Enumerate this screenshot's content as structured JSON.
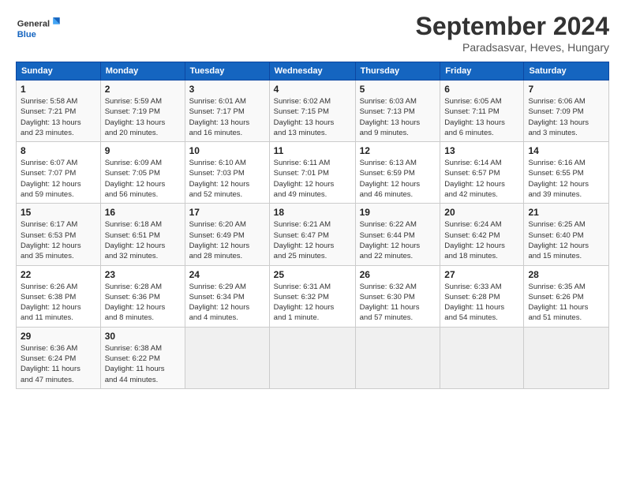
{
  "header": {
    "logo_line1": "General",
    "logo_line2": "Blue",
    "month_year": "September 2024",
    "location": "Paradsasvar, Heves, Hungary"
  },
  "days_of_week": [
    "Sunday",
    "Monday",
    "Tuesday",
    "Wednesday",
    "Thursday",
    "Friday",
    "Saturday"
  ],
  "weeks": [
    [
      {
        "day": "1",
        "info": "Sunrise: 5:58 AM\nSunset: 7:21 PM\nDaylight: 13 hours\nand 23 minutes."
      },
      {
        "day": "2",
        "info": "Sunrise: 5:59 AM\nSunset: 7:19 PM\nDaylight: 13 hours\nand 20 minutes."
      },
      {
        "day": "3",
        "info": "Sunrise: 6:01 AM\nSunset: 7:17 PM\nDaylight: 13 hours\nand 16 minutes."
      },
      {
        "day": "4",
        "info": "Sunrise: 6:02 AM\nSunset: 7:15 PM\nDaylight: 13 hours\nand 13 minutes."
      },
      {
        "day": "5",
        "info": "Sunrise: 6:03 AM\nSunset: 7:13 PM\nDaylight: 13 hours\nand 9 minutes."
      },
      {
        "day": "6",
        "info": "Sunrise: 6:05 AM\nSunset: 7:11 PM\nDaylight: 13 hours\nand 6 minutes."
      },
      {
        "day": "7",
        "info": "Sunrise: 6:06 AM\nSunset: 7:09 PM\nDaylight: 13 hours\nand 3 minutes."
      }
    ],
    [
      {
        "day": "8",
        "info": "Sunrise: 6:07 AM\nSunset: 7:07 PM\nDaylight: 12 hours\nand 59 minutes."
      },
      {
        "day": "9",
        "info": "Sunrise: 6:09 AM\nSunset: 7:05 PM\nDaylight: 12 hours\nand 56 minutes."
      },
      {
        "day": "10",
        "info": "Sunrise: 6:10 AM\nSunset: 7:03 PM\nDaylight: 12 hours\nand 52 minutes."
      },
      {
        "day": "11",
        "info": "Sunrise: 6:11 AM\nSunset: 7:01 PM\nDaylight: 12 hours\nand 49 minutes."
      },
      {
        "day": "12",
        "info": "Sunrise: 6:13 AM\nSunset: 6:59 PM\nDaylight: 12 hours\nand 46 minutes."
      },
      {
        "day": "13",
        "info": "Sunrise: 6:14 AM\nSunset: 6:57 PM\nDaylight: 12 hours\nand 42 minutes."
      },
      {
        "day": "14",
        "info": "Sunrise: 6:16 AM\nSunset: 6:55 PM\nDaylight: 12 hours\nand 39 minutes."
      }
    ],
    [
      {
        "day": "15",
        "info": "Sunrise: 6:17 AM\nSunset: 6:53 PM\nDaylight: 12 hours\nand 35 minutes."
      },
      {
        "day": "16",
        "info": "Sunrise: 6:18 AM\nSunset: 6:51 PM\nDaylight: 12 hours\nand 32 minutes."
      },
      {
        "day": "17",
        "info": "Sunrise: 6:20 AM\nSunset: 6:49 PM\nDaylight: 12 hours\nand 28 minutes."
      },
      {
        "day": "18",
        "info": "Sunrise: 6:21 AM\nSunset: 6:47 PM\nDaylight: 12 hours\nand 25 minutes."
      },
      {
        "day": "19",
        "info": "Sunrise: 6:22 AM\nSunset: 6:44 PM\nDaylight: 12 hours\nand 22 minutes."
      },
      {
        "day": "20",
        "info": "Sunrise: 6:24 AM\nSunset: 6:42 PM\nDaylight: 12 hours\nand 18 minutes."
      },
      {
        "day": "21",
        "info": "Sunrise: 6:25 AM\nSunset: 6:40 PM\nDaylight: 12 hours\nand 15 minutes."
      }
    ],
    [
      {
        "day": "22",
        "info": "Sunrise: 6:26 AM\nSunset: 6:38 PM\nDaylight: 12 hours\nand 11 minutes."
      },
      {
        "day": "23",
        "info": "Sunrise: 6:28 AM\nSunset: 6:36 PM\nDaylight: 12 hours\nand 8 minutes."
      },
      {
        "day": "24",
        "info": "Sunrise: 6:29 AM\nSunset: 6:34 PM\nDaylight: 12 hours\nand 4 minutes."
      },
      {
        "day": "25",
        "info": "Sunrise: 6:31 AM\nSunset: 6:32 PM\nDaylight: 12 hours\nand 1 minute."
      },
      {
        "day": "26",
        "info": "Sunrise: 6:32 AM\nSunset: 6:30 PM\nDaylight: 11 hours\nand 57 minutes."
      },
      {
        "day": "27",
        "info": "Sunrise: 6:33 AM\nSunset: 6:28 PM\nDaylight: 11 hours\nand 54 minutes."
      },
      {
        "day": "28",
        "info": "Sunrise: 6:35 AM\nSunset: 6:26 PM\nDaylight: 11 hours\nand 51 minutes."
      }
    ],
    [
      {
        "day": "29",
        "info": "Sunrise: 6:36 AM\nSunset: 6:24 PM\nDaylight: 11 hours\nand 47 minutes."
      },
      {
        "day": "30",
        "info": "Sunrise: 6:38 AM\nSunset: 6:22 PM\nDaylight: 11 hours\nand 44 minutes."
      },
      {
        "day": "",
        "info": ""
      },
      {
        "day": "",
        "info": ""
      },
      {
        "day": "",
        "info": ""
      },
      {
        "day": "",
        "info": ""
      },
      {
        "day": "",
        "info": ""
      }
    ]
  ]
}
